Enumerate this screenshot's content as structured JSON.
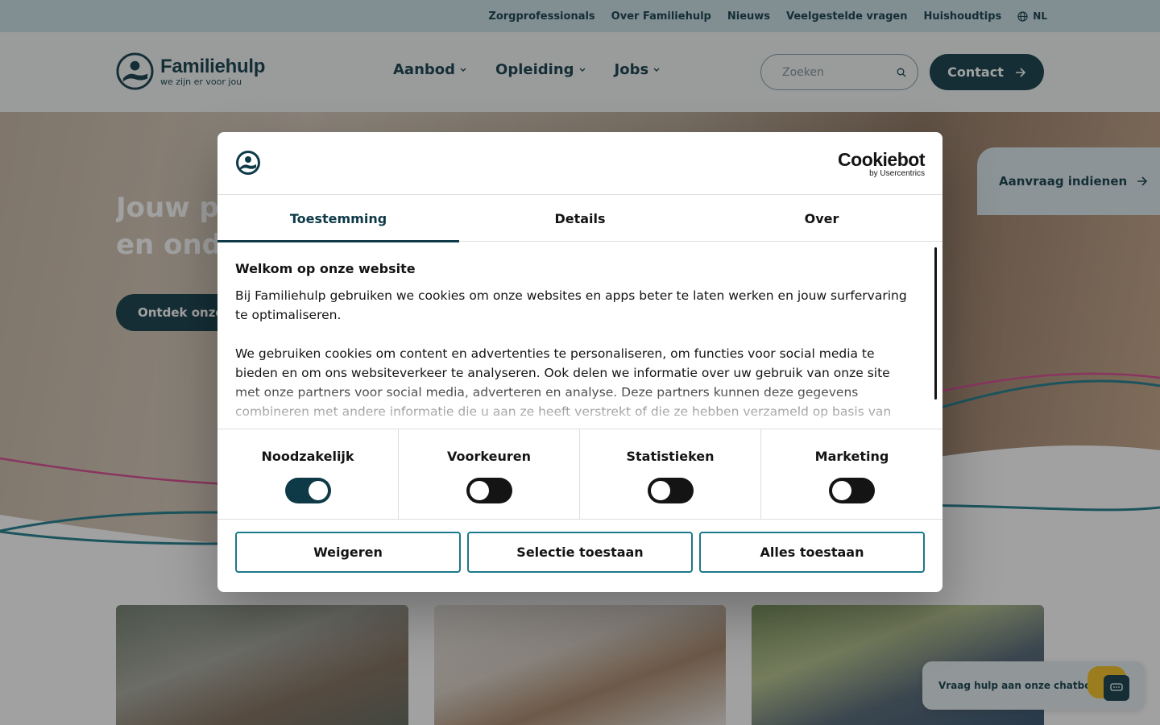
{
  "topbar": {
    "links": [
      "Zorgprofessionals",
      "Over Familiehulp",
      "Nieuws",
      "Veelgestelde vragen",
      "Huishoudtips"
    ],
    "language": "NL"
  },
  "header": {
    "logo_name": "Familiehulp",
    "logo_tagline": "we zijn er voor jou",
    "nav": [
      "Aanbod",
      "Opleiding",
      "Jobs"
    ],
    "search_placeholder": "Zoeken",
    "contact_label": "Contact"
  },
  "hero": {
    "title_line1": "Jouw pa",
    "title_line2": "en onde",
    "cta_label": "Ontdek onze",
    "request_label": "Aanvraag indienen"
  },
  "chatbot": {
    "label": "Vraag hulp aan onze chatbot"
  },
  "cookie_dialog": {
    "brand_name": "Cookiebot",
    "brand_sub": "by Usercentrics",
    "tabs": [
      "Toestemming",
      "Details",
      "Over"
    ],
    "active_tab": "Toestemming",
    "title": "Welkom op onze website",
    "paragraph1": "Bij Familiehulp gebruiken we cookies om onze websites en apps beter te laten werken en jouw surfervaring te optimaliseren.",
    "paragraph2": "We gebruiken cookies om content en advertenties te personaliseren, om functies voor social media te bieden en om ons websiteverkeer te analyseren. Ook delen we informatie over uw gebruik van onze site met onze partners voor social media, adverteren en analyse. Deze partners kunnen deze gegevens combineren met andere informatie die u aan ze heeft verstrekt of die ze hebben verzameld op basis van",
    "toggles": [
      {
        "label": "Noodzakelijk",
        "on": true
      },
      {
        "label": "Voorkeuren",
        "on": false
      },
      {
        "label": "Statistieken",
        "on": false
      },
      {
        "label": "Marketing",
        "on": false
      }
    ],
    "buttons": {
      "reject": "Weigeren",
      "selection": "Selectie toestaan",
      "accept_all": "Alles toestaan"
    }
  },
  "colors": {
    "brand_dark": "#0e3a48",
    "button_border": "#1b7a8a",
    "wave_teal": "#1b7a8a",
    "wave_pink": "#d6468f",
    "chat_accent": "#f4c21f"
  }
}
